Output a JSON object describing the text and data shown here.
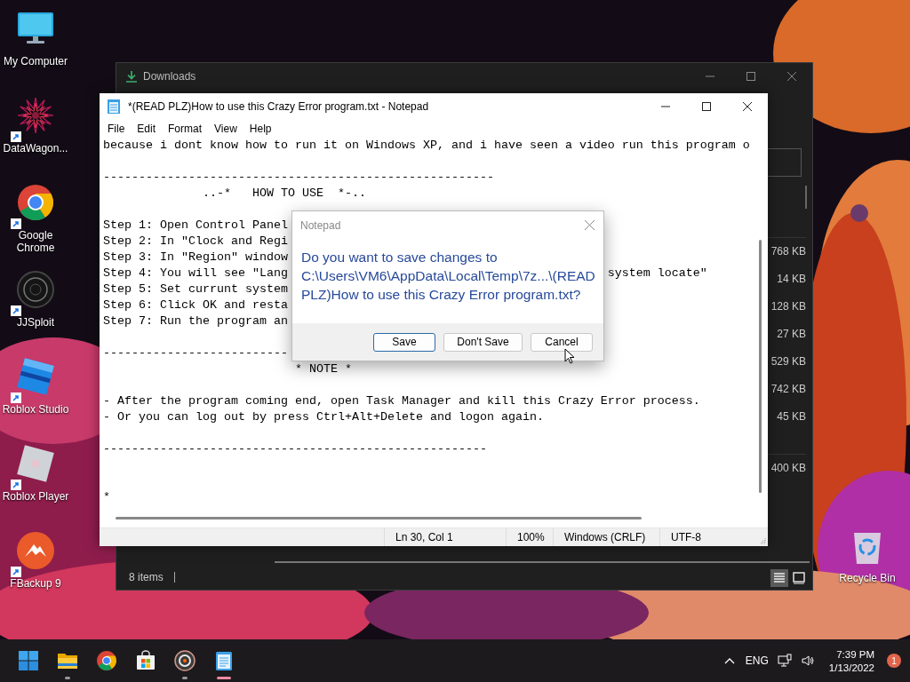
{
  "desktop_icons": [
    {
      "kind": "monitor",
      "label": "My Computer",
      "shortcut": false
    },
    {
      "kind": "star",
      "label": "DataWagon...",
      "shortcut": true
    },
    {
      "kind": "tricolor",
      "label": "Google Chrome",
      "shortcut": true
    },
    {
      "kind": "ring",
      "label": "JJSploit",
      "shortcut": true
    },
    {
      "kind": "bluetile",
      "label": "Roblox Studio",
      "shortcut": true
    },
    {
      "kind": "graytile",
      "label": "Roblox Player",
      "shortcut": true
    },
    {
      "kind": "mountain",
      "label": "FBackup 9",
      "shortcut": true
    }
  ],
  "recycle_bin": {
    "label": "Recycle Bin"
  },
  "explorer": {
    "title": "Downloads",
    "size_groups": [
      {
        "sizes": [
          "768 KB",
          "14 KB",
          "128 KB",
          "27 KB",
          "529 KB",
          "742 KB",
          "45 KB"
        ]
      },
      {
        "sizes": [
          "400 KB"
        ]
      }
    ],
    "status": "8 items",
    "view_buttons": [
      {
        "kind": "details",
        "selected": true
      },
      {
        "kind": "tiles",
        "selected": false
      }
    ]
  },
  "notepad": {
    "title": "*(READ PLZ)How to use this Crazy Error program.txt - Notepad",
    "menu": [
      "File",
      "Edit",
      "Format",
      "View",
      "Help"
    ],
    "lines": [
      {
        "kind": "text",
        "text": "because i dont know how to run it on Windows XP, and i have seen a video run this program o"
      },
      {
        "kind": "blank"
      },
      {
        "kind": "text",
        "text": "-------------------------------------------------------"
      },
      {
        "kind": "text",
        "text": "              ..-*   HOW TO USE  *-.."
      },
      {
        "kind": "blank"
      },
      {
        "kind": "text",
        "text": "Step 1: Open Control Panel"
      },
      {
        "kind": "text",
        "text": "Step 2: In \"Clock and Regi"
      },
      {
        "kind": "text",
        "text": "Step 3: In \"Region\" window"
      },
      {
        "kind": "text",
        "text": "Step 4: You will see \"Lang",
        "tail": "system locate\""
      },
      {
        "kind": "text",
        "text": "Step 5: Set currunt system"
      },
      {
        "kind": "text",
        "text": "Step 6: Click OK and resta"
      },
      {
        "kind": "text",
        "text": "Step 7: Run the program an"
      },
      {
        "kind": "blank"
      },
      {
        "kind": "text",
        "text": "--------------------------"
      },
      {
        "kind": "text",
        "text": "                           * NOTE *"
      },
      {
        "kind": "blank"
      },
      {
        "kind": "text",
        "text": "- After the program coming end, open Task Manager and kill this Crazy Error process."
      },
      {
        "kind": "text",
        "text": "- Or you can log out by press Ctrl+Alt+Delete and logon again."
      },
      {
        "kind": "blank"
      },
      {
        "kind": "text",
        "text": "------------------------------------------------------"
      },
      {
        "kind": "blank"
      },
      {
        "kind": "blank"
      },
      {
        "kind": "text",
        "text": "*"
      }
    ],
    "status_bar": [
      "Ln 30, Col 1",
      "100%",
      "Windows (CRLF)",
      "UTF-8"
    ]
  },
  "dialog": {
    "title": "Notepad",
    "message": "Do you want to save changes to C:\\Users\\VM6\\AppData\\Local\\Temp\\7z...\\(READ PLZ)How to use this Crazy Error program.txt?",
    "buttons": [
      {
        "label": "Save",
        "default": true
      },
      {
        "label": "Don't Save",
        "default": false
      },
      {
        "label": "Cancel",
        "default": false
      }
    ]
  },
  "taskbar": {
    "apps": [
      {
        "kind": "start",
        "running": false,
        "selected": false
      },
      {
        "kind": "folder",
        "running": true,
        "selected": false
      },
      {
        "kind": "tricolor",
        "running": false,
        "selected": false
      },
      {
        "kind": "bag",
        "running": false,
        "selected": false
      },
      {
        "kind": "disc",
        "running": true,
        "selected": false
      },
      {
        "kind": "notepad",
        "running": true,
        "selected": true
      }
    ],
    "language": "ENG",
    "time": "7:39 PM",
    "date": "1/13/2022",
    "notifications": "1"
  }
}
